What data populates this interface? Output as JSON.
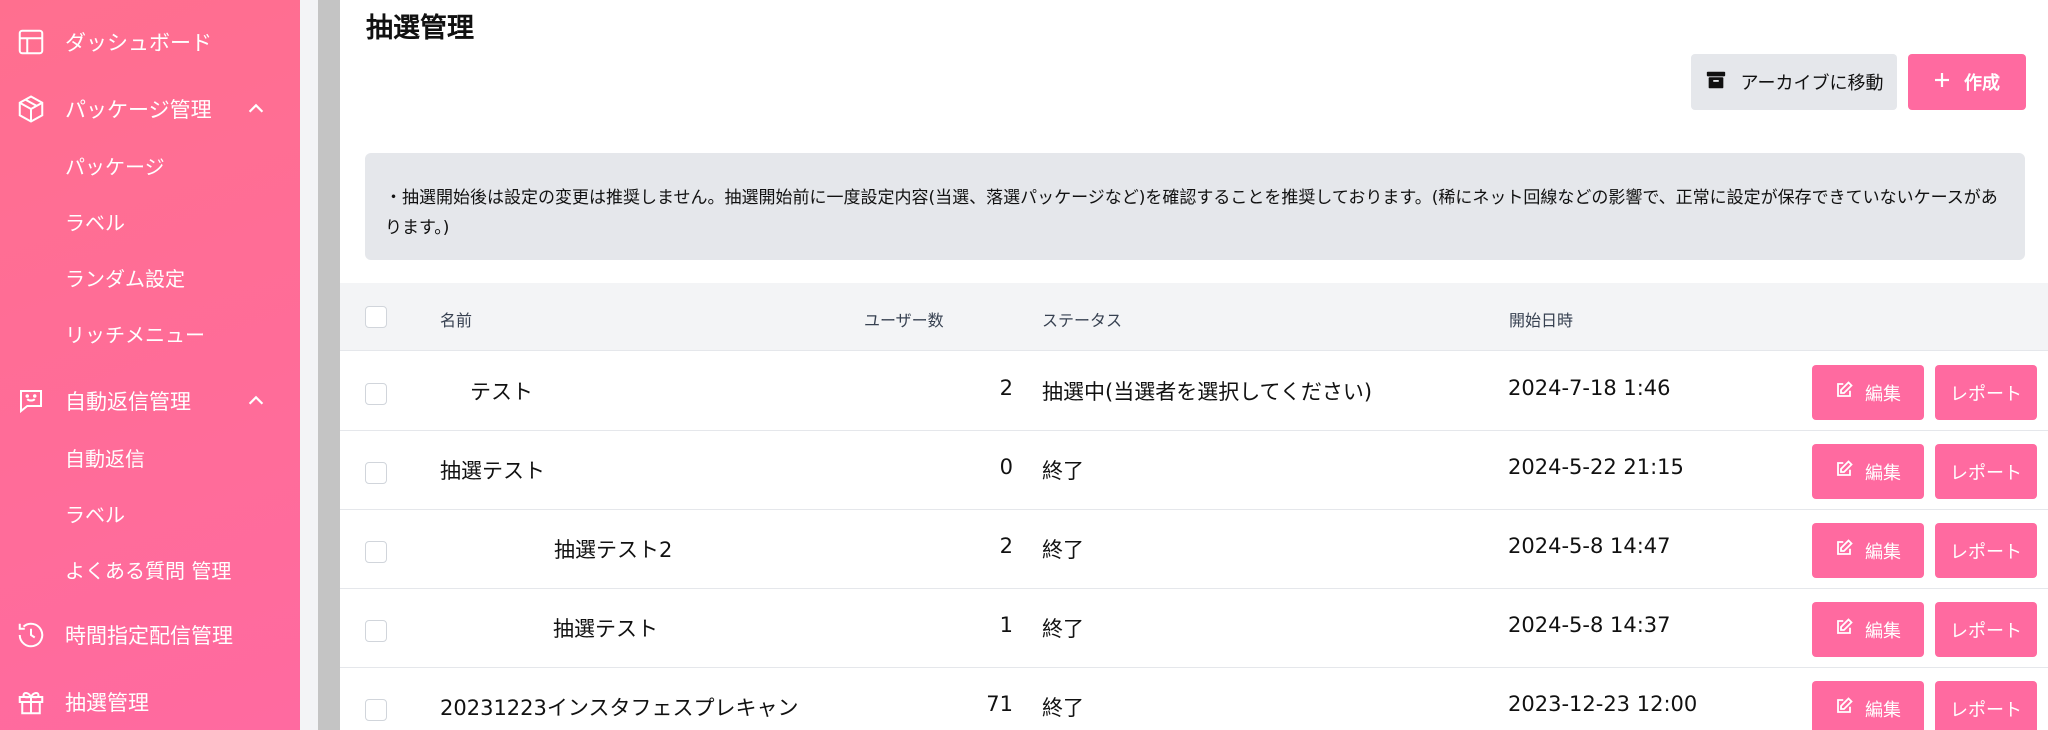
{
  "sidebar": {
    "dashboard": "ダッシュボード",
    "package_mgmt": "パッケージ管理",
    "package_sub": [
      "パッケージ",
      "ラベル",
      "ランダム設定",
      "リッチメニュー"
    ],
    "auto_reply_mgmt": "自動返信管理",
    "auto_reply_sub": [
      "自動返信",
      "ラベル",
      "よくある質問 管理"
    ],
    "scheduled": "時間指定配信管理",
    "lottery": "抽選管理"
  },
  "page": {
    "title": "抽選管理",
    "archive_label": "アーカイブに移動",
    "create_label": "作成",
    "notice": "・抽選開始後は設定の変更は推奨しません。抽選開始前に一度設定内容(当選、落選パッケージなど)を確認することを推奨しております。(稀にネット回線などの影響で、正常に設定が保存できていないケースがあります。)"
  },
  "table": {
    "headers": {
      "name": "名前",
      "users": "ユーザー数",
      "status": "ステータス",
      "start": "開始日時"
    },
    "edit_label": "編集",
    "report_label": "レポート",
    "rows": [
      {
        "name": "テスト",
        "users": "2",
        "status": "抽選中(当選者を選択してください)",
        "start": "2024-7-18 1:46"
      },
      {
        "name": "抽選テスト",
        "users": "0",
        "status": "終了",
        "start": "2024-5-22 21:15"
      },
      {
        "name": "抽選テスト2",
        "users": "2",
        "status": "終了",
        "start": "2024-5-8 14:47"
      },
      {
        "name": "抽選テスト",
        "users": "1",
        "status": "終了",
        "start": "2024-5-8 14:37"
      },
      {
        "name": "20231223インスタフェスプレキャン",
        "users": "71",
        "status": "終了",
        "start": "2023-12-23 12:00"
      }
    ]
  },
  "colors": {
    "accent": "#ff6aa0",
    "sidebar": "#ff6f8f",
    "archive_bg": "#e5e7eb"
  }
}
